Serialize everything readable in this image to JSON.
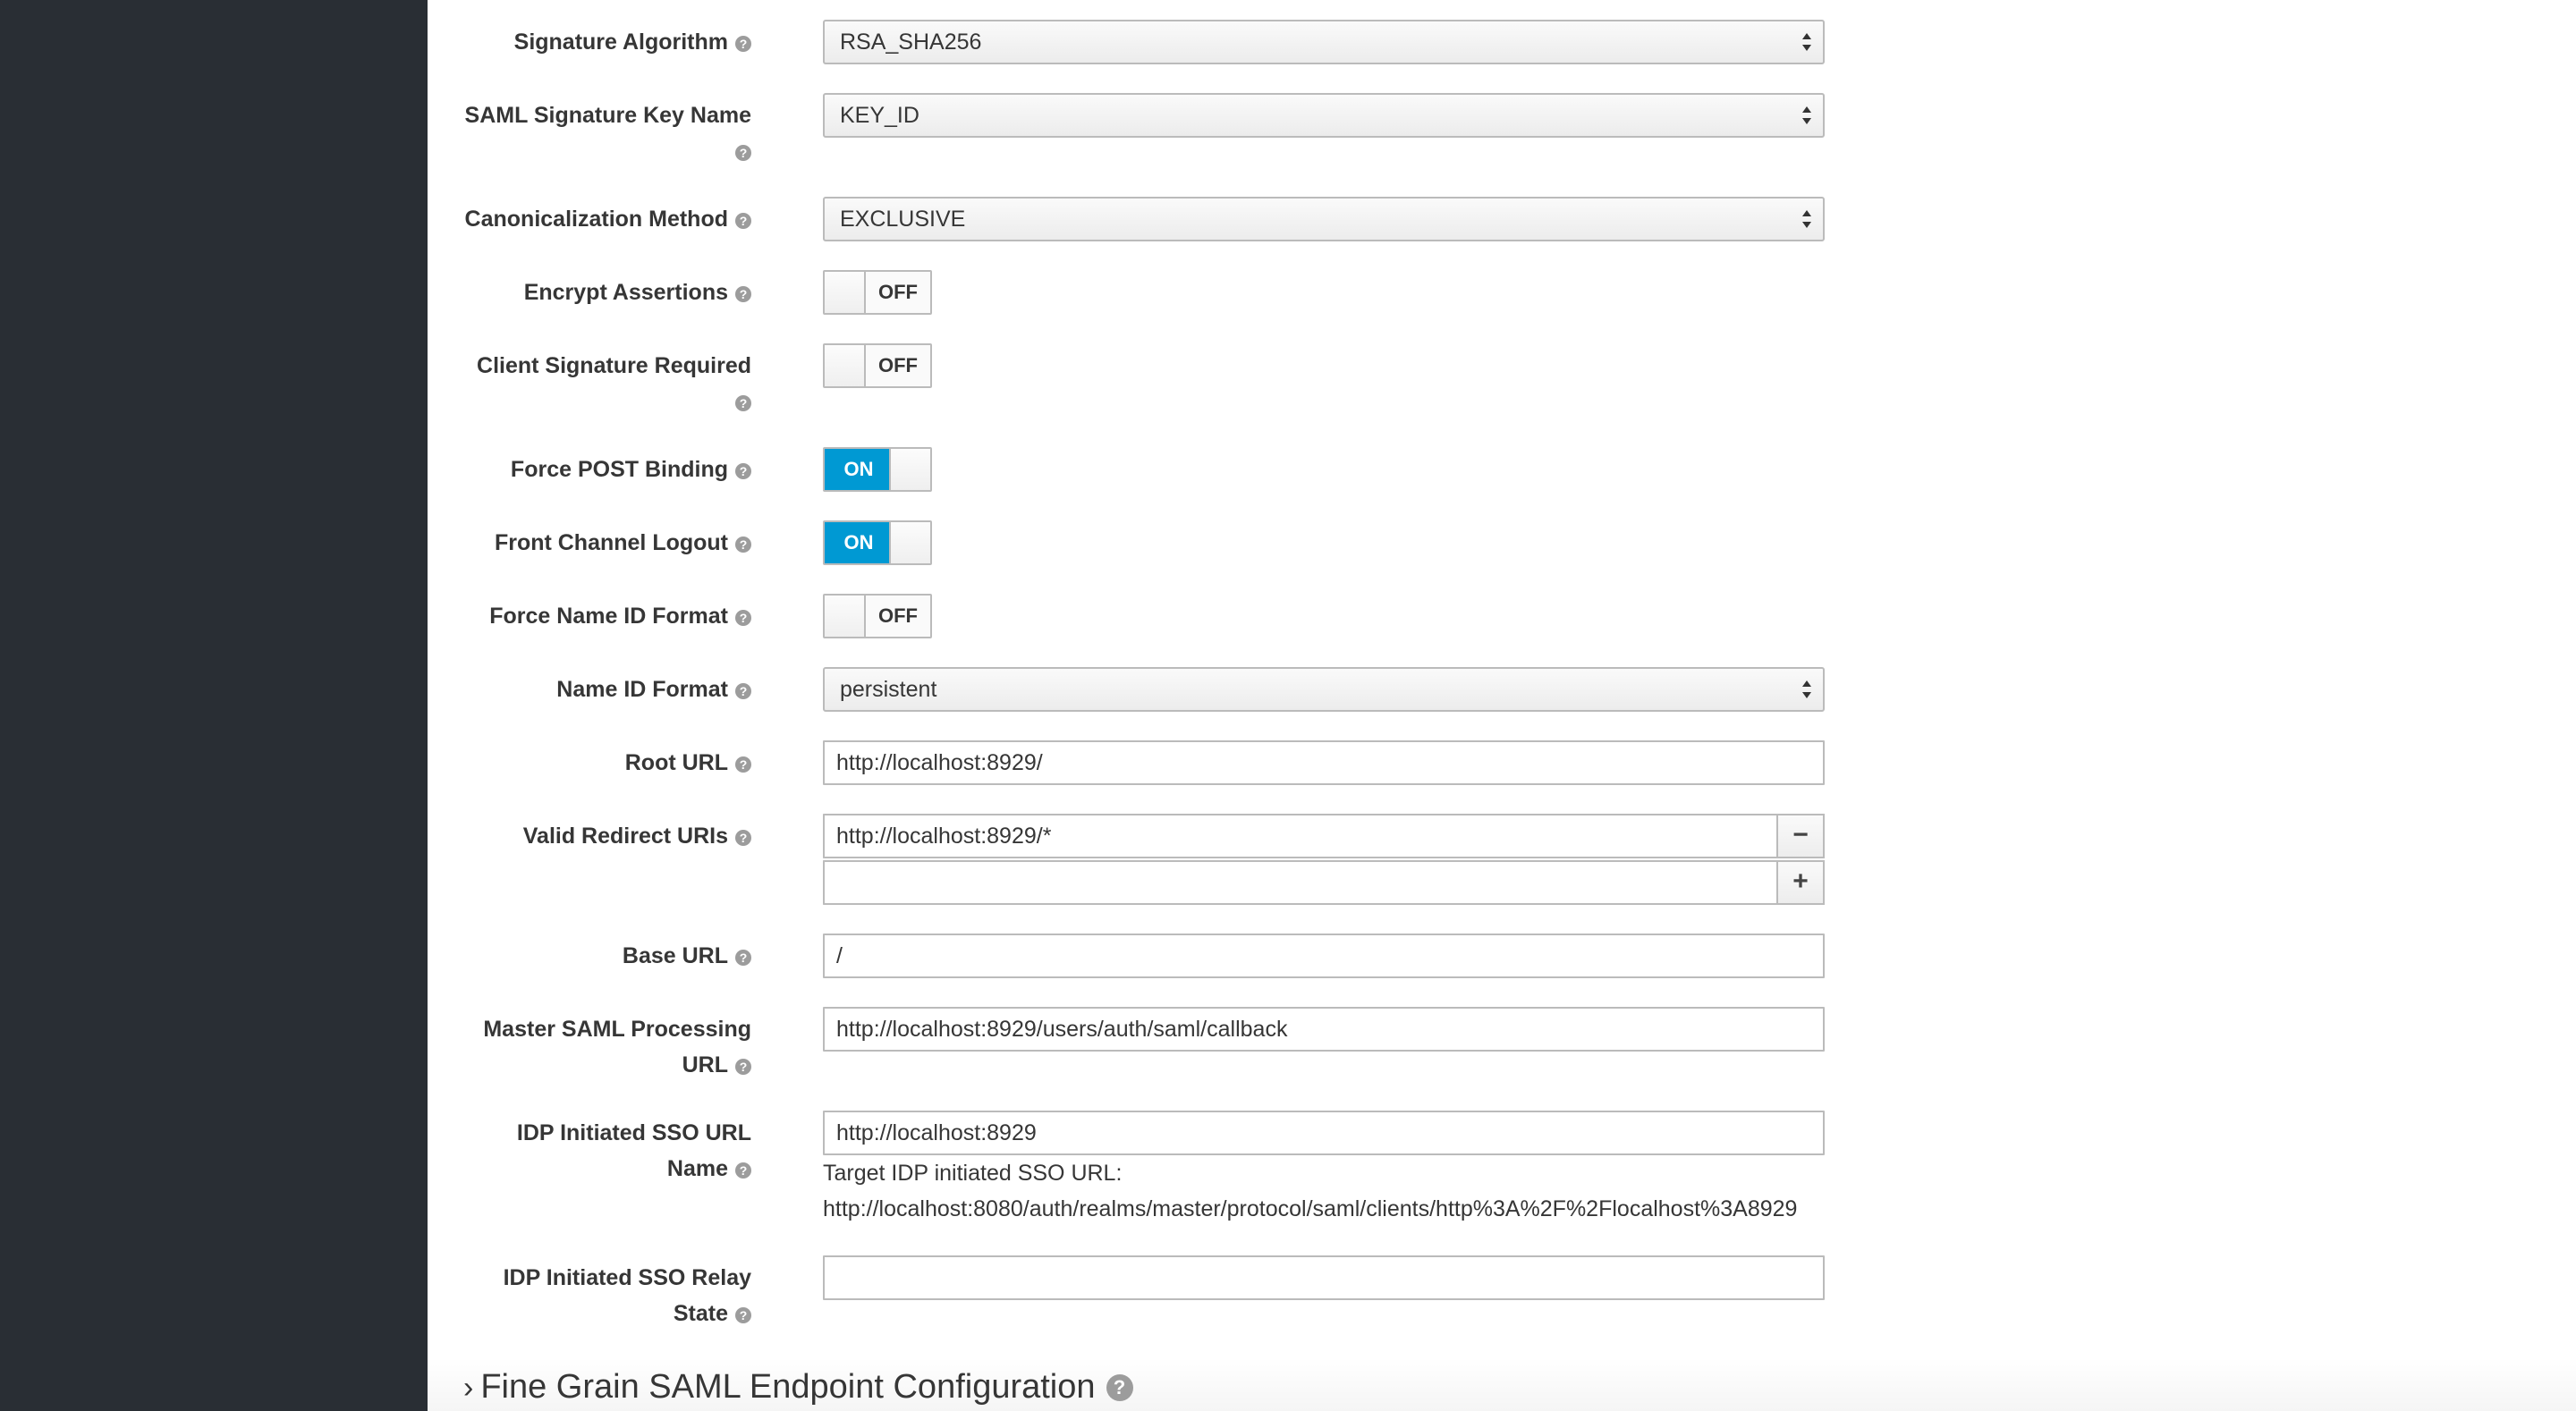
{
  "form": {
    "signature_algorithm": {
      "label": "Signature Algorithm",
      "value": "RSA_SHA256"
    },
    "saml_signature_key_name": {
      "label": "SAML Signature Key Name",
      "value": "KEY_ID"
    },
    "canonicalization_method": {
      "label": "Canonicalization Method",
      "value": "EXCLUSIVE"
    },
    "encrypt_assertions": {
      "label": "Encrypt Assertions",
      "state": "OFF"
    },
    "client_signature_required": {
      "label": "Client Signature Required",
      "state": "OFF"
    },
    "force_post_binding": {
      "label": "Force POST Binding",
      "state": "ON"
    },
    "front_channel_logout": {
      "label": "Front Channel Logout",
      "state": "ON"
    },
    "force_name_id_format": {
      "label": "Force Name ID Format",
      "state": "OFF"
    },
    "name_id_format": {
      "label": "Name ID Format",
      "value": "persistent"
    },
    "root_url": {
      "label": "Root URL",
      "value": "http://localhost:8929/"
    },
    "valid_redirect_uris": {
      "label": "Valid Redirect URIs",
      "values": [
        "http://localhost:8929/*",
        ""
      ],
      "remove_symbol": "−",
      "add_symbol": "+"
    },
    "base_url": {
      "label": "Base URL",
      "value": "/"
    },
    "master_saml_processing_url": {
      "label_line1": "Master SAML Processing",
      "label_line2": "URL",
      "value": "http://localhost:8929/users/auth/saml/callback"
    },
    "idp_initiated_sso_url_name": {
      "label_line1": "IDP Initiated SSO URL",
      "label_line2": "Name",
      "value": "http://localhost:8929",
      "help_line1": "Target IDP initiated SSO URL:",
      "help_line2": "http://localhost:8080/auth/realms/master/protocol/saml/clients/http%3A%2F%2Flocalhost%3A8929"
    },
    "idp_initiated_sso_relay_state": {
      "label_line1": "IDP Initiated SSO Relay",
      "label_line2": "State",
      "value": ""
    }
  },
  "section": {
    "title": "Fine Grain SAML Endpoint Configuration"
  },
  "icons": {
    "help": "question-circle-icon",
    "expand": "chevron-right-icon"
  },
  "colors": {
    "sidebar": "#292e34",
    "toggle_on": "#0099d3"
  }
}
